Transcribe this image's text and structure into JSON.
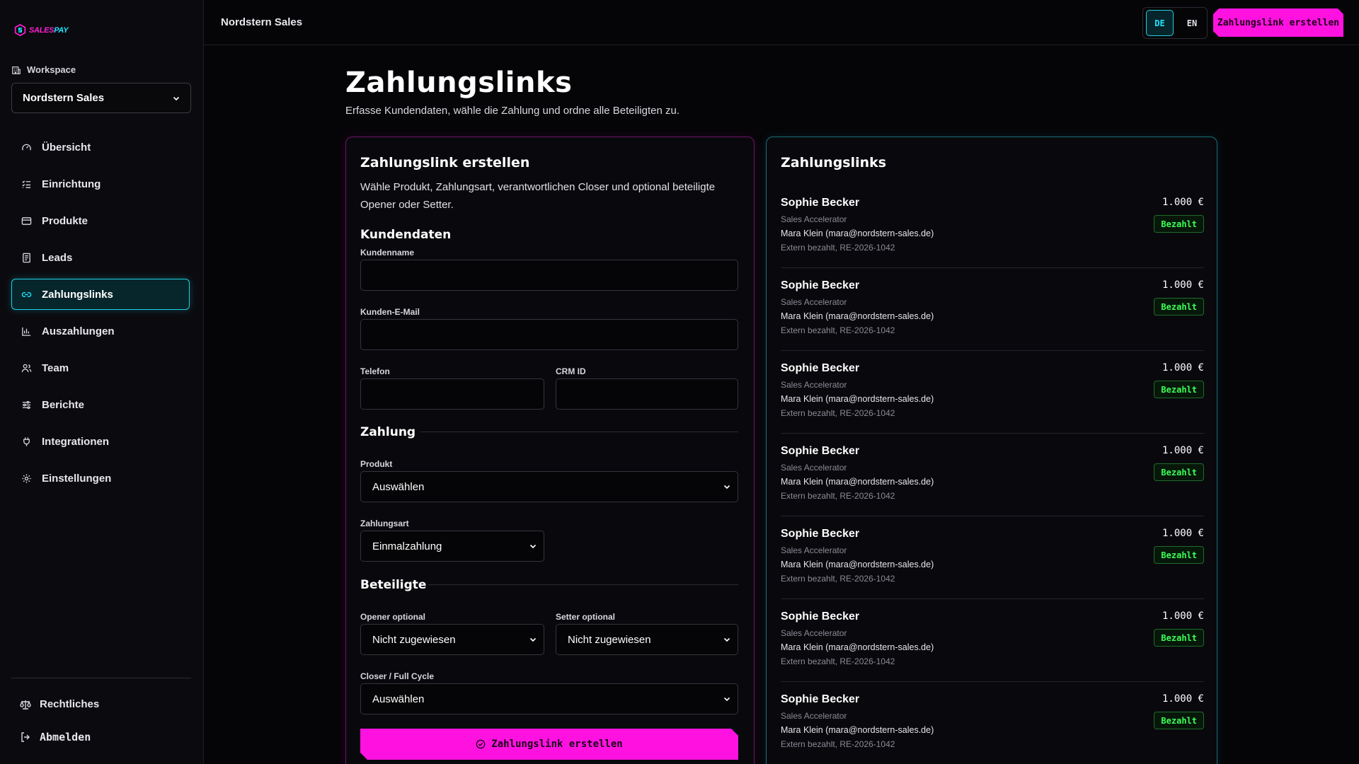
{
  "brand": {
    "part1": "SALES",
    "part2": "PAY"
  },
  "workspace": {
    "label": "Workspace",
    "selected": "Nordstern Sales"
  },
  "nav": [
    {
      "id": "overview",
      "label": "Übersicht",
      "icon": "gauge-icon"
    },
    {
      "id": "setup",
      "label": "Einrichtung",
      "icon": "checklist-icon"
    },
    {
      "id": "products",
      "label": "Produkte",
      "icon": "card-icon"
    },
    {
      "id": "leads",
      "label": "Leads",
      "icon": "document-icon"
    },
    {
      "id": "paymentlinks",
      "label": "Zahlungslinks",
      "icon": "link-icon",
      "active": true
    },
    {
      "id": "payouts",
      "label": "Auszahlungen",
      "icon": "bar-chart-icon"
    },
    {
      "id": "team",
      "label": "Team",
      "icon": "users-icon"
    },
    {
      "id": "reports",
      "label": "Berichte",
      "icon": "sliders-icon"
    },
    {
      "id": "integrations",
      "label": "Integrationen",
      "icon": "plug-icon"
    },
    {
      "id": "settings",
      "label": "Einstellungen",
      "icon": "gear-icon"
    }
  ],
  "footer_nav": {
    "legal": "Rechtliches",
    "logout": "Abmelden"
  },
  "topbar": {
    "title": "Nordstern Sales",
    "lang_de": "DE",
    "lang_en": "EN",
    "cta": "Zahlungslink erstellen"
  },
  "page": {
    "title": "Zahlungslinks",
    "subtitle": "Erfasse Kundendaten, wähle die Zahlung und ordne alle Beteiligten zu."
  },
  "form": {
    "title": "Zahlungslink erstellen",
    "description": "Wähle Produkt, Zahlungsart, verantwortlichen Closer und optional beteiligte Opener oder Setter.",
    "customer_section": "Kundendaten",
    "customer_name_label": "Kundenname",
    "customer_name_value": "",
    "customer_email_label": "Kunden-E-Mail",
    "customer_email_value": "",
    "phone_label": "Telefon",
    "phone_value": "",
    "crm_label": "CRM ID",
    "crm_value": "",
    "payment_section": "Zahlung",
    "product_label": "Produkt",
    "product_value": "Auswählen",
    "paytype_label": "Zahlungsart",
    "paytype_value": "Einmalzahlung",
    "participants_section": "Beteiligte",
    "opener_label": "Opener optional",
    "opener_value": "Nicht zugewiesen",
    "setter_label": "Setter optional",
    "setter_value": "Nicht zugewiesen",
    "closer_label": "Closer / Full Cycle",
    "closer_value": "Auswählen",
    "submit": "Zahlungslink erstellen"
  },
  "list": {
    "title": "Zahlungslinks",
    "items": [
      {
        "name": "Sophie Becker",
        "product": "Sales Accelerator",
        "person": "Mara Klein (mara@nordstern-sales.de)",
        "meta": "Extern bezahlt, RE-2026-1042",
        "amount": "1.000 €",
        "status": "Bezahlt"
      },
      {
        "name": "Sophie Becker",
        "product": "Sales Accelerator",
        "person": "Mara Klein (mara@nordstern-sales.de)",
        "meta": "Extern bezahlt, RE-2026-1042",
        "amount": "1.000 €",
        "status": "Bezahlt"
      },
      {
        "name": "Sophie Becker",
        "product": "Sales Accelerator",
        "person": "Mara Klein (mara@nordstern-sales.de)",
        "meta": "Extern bezahlt, RE-2026-1042",
        "amount": "1.000 €",
        "status": "Bezahlt"
      },
      {
        "name": "Sophie Becker",
        "product": "Sales Accelerator",
        "person": "Mara Klein (mara@nordstern-sales.de)",
        "meta": "Extern bezahlt, RE-2026-1042",
        "amount": "1.000 €",
        "status": "Bezahlt"
      },
      {
        "name": "Sophie Becker",
        "product": "Sales Accelerator",
        "person": "Mara Klein (mara@nordstern-sales.de)",
        "meta": "Extern bezahlt, RE-2026-1042",
        "amount": "1.000 €",
        "status": "Bezahlt"
      },
      {
        "name": "Sophie Becker",
        "product": "Sales Accelerator",
        "person": "Mara Klein (mara@nordstern-sales.de)",
        "meta": "Extern bezahlt, RE-2026-1042",
        "amount": "1.000 €",
        "status": "Bezahlt"
      },
      {
        "name": "Sophie Becker",
        "product": "Sales Accelerator",
        "person": "Mara Klein (mara@nordstern-sales.de)",
        "meta": "Extern bezahlt, RE-2026-1042",
        "amount": "1.000 €",
        "status": "Bezahlt"
      }
    ]
  },
  "colors": {
    "accent_pink": "#ff12e0",
    "accent_cyan": "#20e3ff",
    "status_green": "#3bff57"
  }
}
